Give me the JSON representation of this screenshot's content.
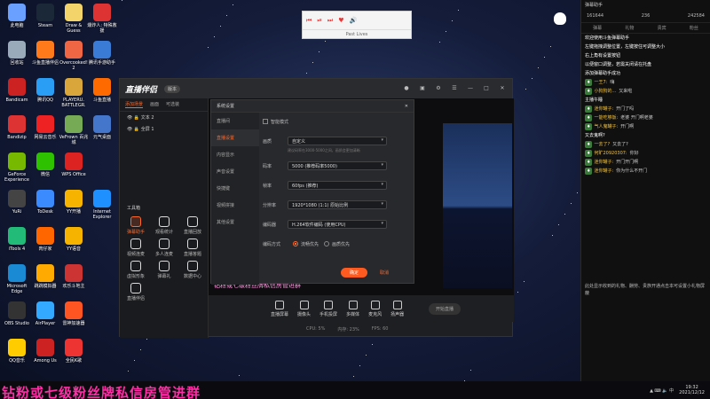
{
  "desktop": [
    {
      "label": "此电脑",
      "color": "#6aa0ff"
    },
    {
      "label": "Steam",
      "color": "#1b2838"
    },
    {
      "label": "Draw & Guess",
      "color": "#f3d46a"
    },
    {
      "label": "爆炸人: 特殊救援",
      "color": "#d33"
    },
    {
      "label": "回收站",
      "color": "#9ab"
    },
    {
      "label": "斗鱼直播伴侣",
      "color": "#ff7a1a"
    },
    {
      "label": "Overcooked! 2",
      "color": "#e64"
    },
    {
      "label": "腾讯手游助手",
      "color": "#3a7bd5"
    },
    {
      "label": "Bandicam",
      "color": "#c22"
    },
    {
      "label": "腾讯QQ",
      "color": "#2a9df4"
    },
    {
      "label": "PLAYERU. BATTLEGR.",
      "color": "#d8a63a"
    },
    {
      "label": "斗鱼直播",
      "color": "#ff6a00"
    },
    {
      "label": "Bandizip",
      "color": "#d33"
    },
    {
      "label": "网易云音乐",
      "color": "#e22"
    },
    {
      "label": "VeFrown 百兆城",
      "color": "#7a5"
    },
    {
      "label": "元气桌面",
      "color": "#47c"
    },
    {
      "label": "GeForce Experience",
      "color": "#76b900"
    },
    {
      "label": "微信",
      "color": "#2dc100"
    },
    {
      "label": "WPS Office",
      "color": "#d22"
    },
    {
      "label": "",
      "color": "#000"
    },
    {
      "label": "YuRi",
      "color": "#444"
    },
    {
      "label": "ToDesk",
      "color": "#3b8bff"
    },
    {
      "label": "YY开播",
      "color": "#f6b400"
    },
    {
      "label": "Internet Explorer",
      "color": "#1e90ff"
    },
    {
      "label": "iTools 4",
      "color": "#2b7"
    },
    {
      "label": "肉仔家",
      "color": "#f60"
    },
    {
      "label": "YY语音",
      "color": "#f6b400"
    },
    {
      "label": "",
      "color": "#000"
    },
    {
      "label": "Microsoft Edge",
      "color": "#1a8ad4"
    },
    {
      "label": "跳跳模拟器",
      "color": "#fa0"
    },
    {
      "label": "欢乐斗地主",
      "color": "#c33"
    },
    {
      "label": "",
      "color": "#000"
    },
    {
      "label": "OBS Studio",
      "color": "#333"
    },
    {
      "label": "AirPlayer",
      "color": "#3af"
    },
    {
      "label": "雷神加速器",
      "color": "#f52"
    },
    {
      "label": "",
      "color": "#000"
    },
    {
      "label": "QQ音乐",
      "color": "#fc0"
    },
    {
      "label": "Among Us",
      "color": "#c22"
    },
    {
      "label": "全民K歌",
      "color": "#e33"
    },
    {
      "label": "",
      "color": "#000"
    }
  ],
  "player": {
    "title": "Past Lives",
    "controls": [
      "⏮",
      "⏯",
      "⏭",
      "♥",
      "🔊"
    ]
  },
  "chat": {
    "title": "弹幕助手",
    "stats": {
      "fans": "161644",
      "online": "236",
      "gift": "242584"
    },
    "tabs": [
      "弹幕",
      "礼物",
      "贵宾",
      "粉丝"
    ],
    "messages": [
      {
        "badge": "",
        "user": "",
        "text": "欢迎使用斗鱼弹幕助手"
      },
      {
        "badge": "",
        "user": "",
        "text": "左键拖拽调整位置，左键按住可调整大小"
      },
      {
        "badge": "",
        "user": "",
        "text": "右上角有设置按钮"
      },
      {
        "badge": "",
        "user": "",
        "text": "以便窗口调整，若需关闭请在托盘"
      },
      {
        "badge": "",
        "user": "",
        "text": "添加弹幕助手成功"
      },
      {
        "badge": "",
        "user": "一王7:",
        "text": "嗨"
      },
      {
        "badge": "",
        "user": "小狗狗的...",
        "text": "又来啦"
      },
      {
        "badge": "",
        "user": "",
        "text": "主播午睡"
      },
      {
        "badge": "",
        "user": "迷你罐子:",
        "text": "开门了吗"
      },
      {
        "badge": "",
        "user": "一能吃够饭:",
        "text": "老婆 开门啊老婆"
      },
      {
        "badge": "",
        "user": "气人鬼罐子:",
        "text": "开门啊"
      },
      {
        "badge": "",
        "user": "",
        "text": "又去鬼啊?"
      },
      {
        "badge": "",
        "user": "一去了?",
        "text": "又去了?"
      },
      {
        "badge": "",
        "user": "何旷20920307:",
        "text": "你好"
      },
      {
        "badge": "",
        "user": "迷你罐子:",
        "text": "开门开门啊"
      },
      {
        "badge": "",
        "user": "迷你罐子:",
        "text": "你为什么不开门"
      }
    ],
    "footer": "此处显示收到的礼物、酬劳、贵族开通点击本可设置小礼物屏蔽"
  },
  "app": {
    "logo": "直播伴侣",
    "version": "版本",
    "left_tabs": [
      "添加场景",
      "画面",
      "可选装"
    ],
    "scenes": [
      "文本 2",
      "全屏 1"
    ],
    "tools_header": "工具箱",
    "tools": [
      "弹幕助手",
      "观看统计",
      "直播回放",
      "视频连麦",
      "多人连麦",
      "直播答题",
      "虚拟形象",
      "弹幕礼",
      "数据中心",
      "",
      "",
      "直播伴侣"
    ],
    "bottom_buttons": [
      "直播屏幕",
      "摄像头",
      "手机投屏",
      "多媒体",
      "麦克风",
      "扬声器"
    ],
    "start_label": "开始直播",
    "footer": [
      "CPU: 5%",
      "内存: 23%",
      "FPS: 60"
    ],
    "stream_label": "钻粉或七级粉丝牌私信房管进群"
  },
  "settings": {
    "title": "系统设置",
    "menu": [
      "直播间",
      "直播设置",
      "内容显示",
      "声音设置",
      "快捷键",
      "视频拼接",
      "其他设置"
    ],
    "active": "直播设置",
    "pro_mode": "智能模式",
    "fields": [
      {
        "k": "画质",
        "v": "自定义"
      },
      {
        "k": "码率",
        "v": "5000 (推荐码率5000)"
      },
      {
        "k": "帧率",
        "v": "60fps (推荐)"
      },
      {
        "k": "分辨率",
        "v": "1920*1080 (1:1) 原始比例"
      },
      {
        "k": "编码器",
        "v": "H.264软件编码 (使用CPU)"
      }
    ],
    "hint": "建议码率在3000-5000之间，画质会更加清晰",
    "encoding_label": "编码方式",
    "encoding_opts": [
      "流畅优先",
      "画质优先"
    ],
    "ok": "确定",
    "cancel": "取消"
  },
  "taskbar": {
    "time": "19:32",
    "date": "2021/12/12"
  },
  "banner": "钻粉或七级粉丝牌私信房管进群"
}
